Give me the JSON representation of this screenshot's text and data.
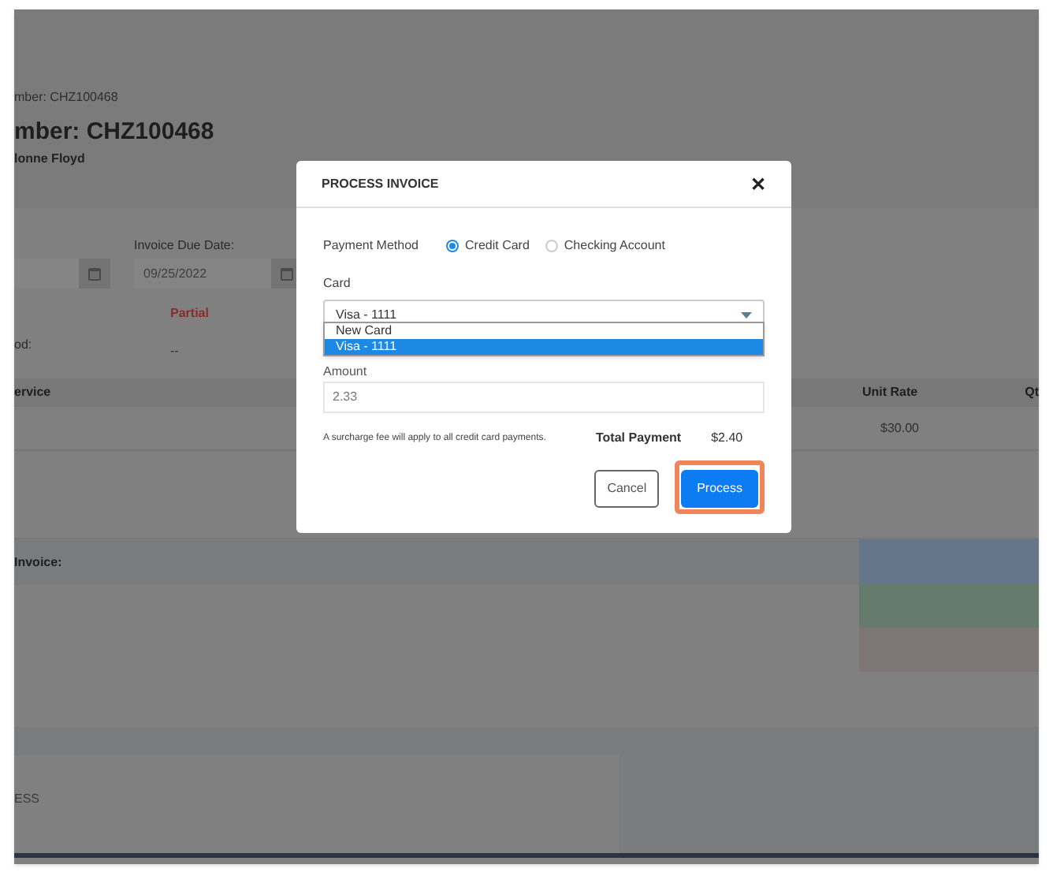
{
  "page": {
    "breadcrumb": "mber: CHZ100468",
    "title": "mber: CHZ100468",
    "customer": "lonne Floyd",
    "fields": {
      "due_date_label": "Invoice Due Date:",
      "due_date": "09/25/2022",
      "status": "Partial",
      "method_label": "od:",
      "method": "--"
    },
    "table": {
      "columns": [
        "ervice",
        "Unit Rate",
        "Qt"
      ],
      "rows": [
        {
          "unit_rate": "$30.00"
        }
      ]
    },
    "invoice_section": "Invoice:",
    "address_section": "ESS",
    "summary_cells": [
      {
        "color": "#66758a"
      },
      {
        "color": "#677a6e"
      },
      {
        "color": "#7e7676"
      }
    ]
  },
  "dialog": {
    "title": "PROCESS INVOICE",
    "close": "✕",
    "payment_method": {
      "label": "Payment Method",
      "options": [
        {
          "label": "Credit Card",
          "selected": true
        },
        {
          "label": "Checking Account",
          "selected": false
        }
      ]
    },
    "card": {
      "label": "Card",
      "value": "Visa - 1111",
      "options": [
        {
          "label": "New Card",
          "selected": false
        },
        {
          "label": "Visa - 1111",
          "selected": true
        }
      ]
    },
    "amount": {
      "label": "Amount",
      "value": "2.33"
    },
    "note": "A surcharge fee will apply to all credit card payments.",
    "total_label": "Total Payment",
    "total": "$2.40",
    "buttons": [
      {
        "label": "Cancel",
        "kind": "secondary",
        "focused": false
      },
      {
        "label": "Process",
        "kind": "primary",
        "focused": true
      }
    ]
  }
}
